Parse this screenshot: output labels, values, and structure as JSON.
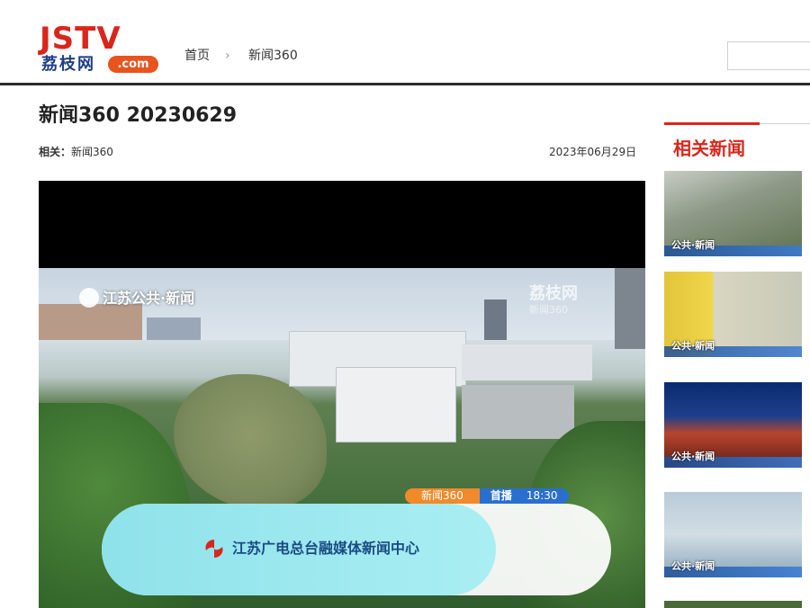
{
  "header": {
    "logo_main": "JSTV",
    "logo_cn": "荔枝网",
    "logo_com": ".com",
    "breadcrumb_home": "首页",
    "breadcrumb_sep": "›",
    "breadcrumb_current": "新闻360"
  },
  "article": {
    "title": "新闻360 20230629",
    "related_label": "相关：",
    "related_value": "新闻360",
    "date": "2023年06月29日"
  },
  "video": {
    "channel_logo": "江苏公共·新闻",
    "watermark": "荔枝网",
    "watermark_sub": "新闻360",
    "schedule_program": "新闻360",
    "schedule_type": "首播",
    "schedule_time": "18:30",
    "banner_text": "江苏广电总台融媒体新闻中心"
  },
  "sidebar": {
    "title": "相关新闻",
    "thumbs": [
      {
        "caption": "公共·新闻"
      },
      {
        "caption": "公共·新闻"
      },
      {
        "caption": "公共·新闻"
      },
      {
        "caption": "公共·新闻"
      }
    ]
  },
  "colors": {
    "brand_red": "#d9261c",
    "brand_blue": "#1d3f86",
    "accent_orange": "#e8531e"
  }
}
